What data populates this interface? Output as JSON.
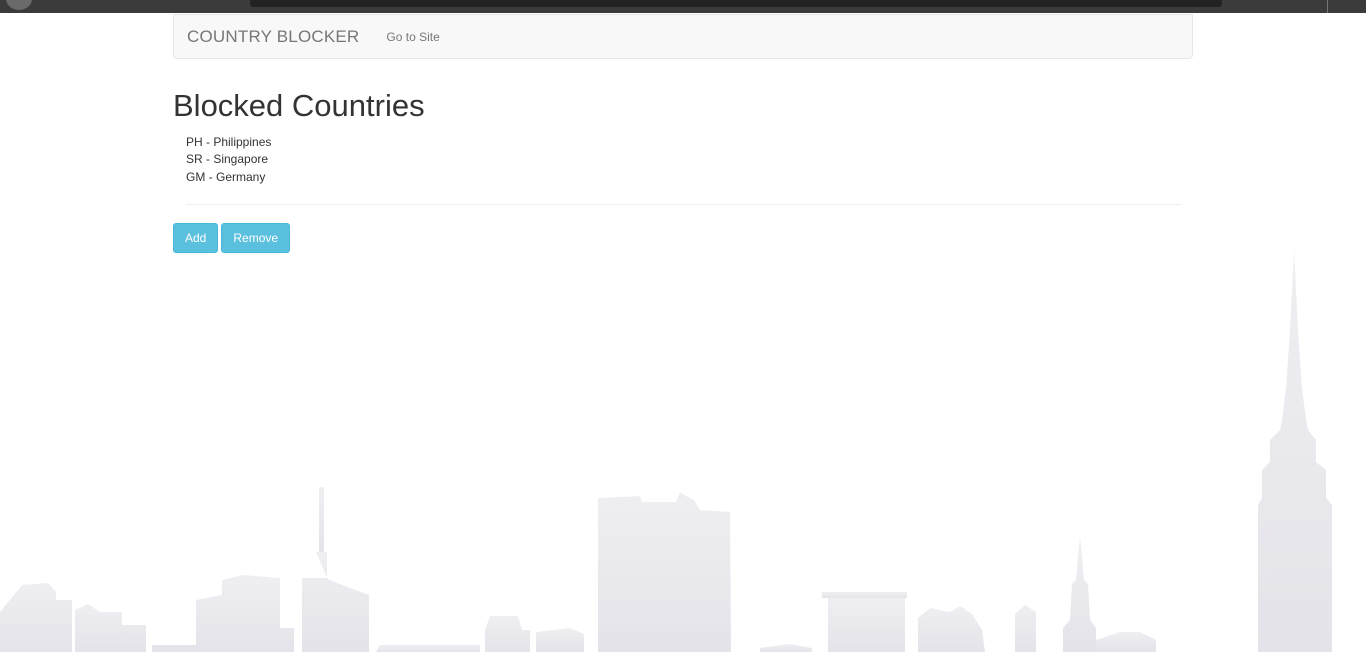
{
  "navbar": {
    "brand": "COUNTRY BLOCKER",
    "go_to_site": "Go to Site"
  },
  "main": {
    "title": "Blocked Countries",
    "countries": [
      "PH - Philippines",
      "SR - Singapore",
      "GM - Germany"
    ],
    "buttons": {
      "add": "Add",
      "remove": "Remove"
    }
  },
  "colors": {
    "button_info": "#5bc0de",
    "navbar_bg": "#f8f8f8",
    "skyline": "#e8e7ec"
  }
}
